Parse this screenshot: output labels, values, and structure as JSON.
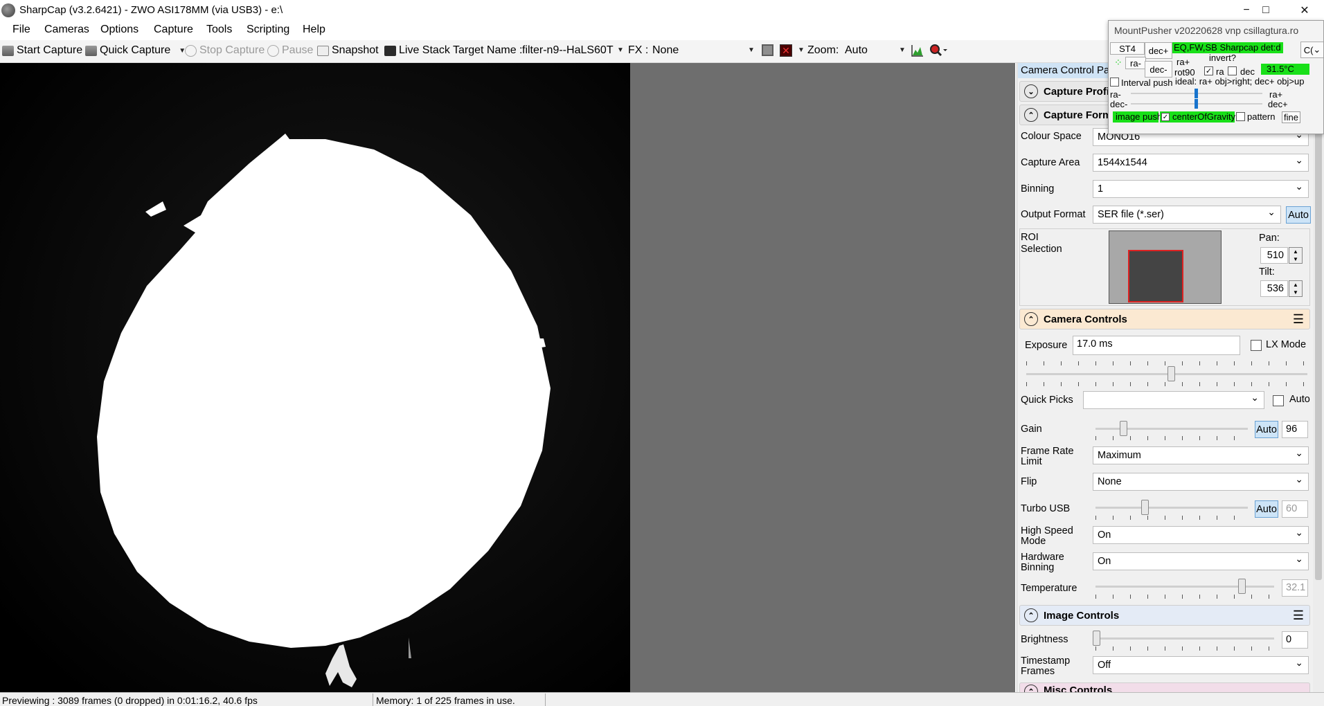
{
  "window": {
    "title": "SharpCap (v3.2.6421) - ZWO ASI178MM (via USB3) - e:\\",
    "minimize": "−",
    "maximize": "□",
    "close": "✕"
  },
  "menu": [
    "File",
    "Cameras",
    "Options",
    "Capture",
    "Tools",
    "Scripting",
    "Help"
  ],
  "toolbar": {
    "start_capture": "Start Capture",
    "quick_capture": "Quick Capture",
    "stop_capture": "Stop Capture",
    "pause": "Pause",
    "snapshot": "Snapshot",
    "live_stack": "Live Stack",
    "target_name_label": "Target Name :",
    "target_name_value": "filter-n9--HaLS60T",
    "fx_label": "FX :",
    "fx_value": "None",
    "zoom_label": "Zoom:",
    "zoom_value": "Auto"
  },
  "panel": {
    "title": "Camera Control Pa",
    "capture_profile": "Capture Profile",
    "capture_format": "Capture Forma",
    "colour_space_label": "Colour Space",
    "colour_space_value": "MONO16",
    "capture_area_label": "Capture Area",
    "capture_area_value": "1544x1544",
    "binning_label": "Binning",
    "binning_value": "1",
    "output_format_label": "Output Format",
    "output_format_value": "SER file (*.ser)",
    "output_format_auto": "Auto",
    "roi_label_1": "ROI",
    "roi_label_2": "Selection",
    "pan_label": "Pan:",
    "pan_value": "510",
    "tilt_label": "Tilt:",
    "tilt_value": "536",
    "camera_controls": "Camera Controls",
    "exposure_label": "Exposure",
    "exposure_value": "17.0 ms",
    "lx_mode": "LX Mode",
    "quick_picks_label": "Quick Picks",
    "quick_picks_auto": "Auto",
    "gain_label": "Gain",
    "gain_auto": "Auto",
    "gain_value": "96",
    "frame_rate_label_1": "Frame Rate",
    "frame_rate_label_2": "Limit",
    "frame_rate_value": "Maximum",
    "flip_label": "Flip",
    "flip_value": "None",
    "turbo_usb_label": "Turbo USB",
    "turbo_usb_auto": "Auto",
    "turbo_usb_value": "60",
    "high_speed_label_1": "High Speed",
    "high_speed_label_2": "Mode",
    "high_speed_value": "On",
    "hw_binning_label_1": "Hardware",
    "hw_binning_label_2": "Binning",
    "hw_binning_value": "On",
    "temperature_label": "Temperature",
    "temperature_value": "32.1",
    "image_controls": "Image Controls",
    "brightness_label": "Brightness",
    "brightness_value": "0",
    "timestamp_label_1": "Timestamp",
    "timestamp_label_2": "Frames",
    "timestamp_value": "Off",
    "misc_controls": "Misc Controls"
  },
  "mountpusher": {
    "title": "MountPusher v20220628 vnp csillagtura.ro",
    "st4": "ST4",
    "ra_minus": "ra-",
    "dec_plus": "dec+",
    "dec_minus": "dec-",
    "status": "EQ,FW,SB Sharpcap det:d",
    "ra_plus": "ra+",
    "rot90": "rot90",
    "invert": "invert?",
    "ra": "ra",
    "dec": "dec",
    "temp": "31.5°C",
    "interval_push": "Interval push",
    "ideal": "ideal: ra+ obj>right; dec+ obj>up",
    "slider_ra_minus": "ra-",
    "slider_dec_minus": "dec-",
    "slider_ra_plus": "ra+",
    "slider_dec_plus": "dec+",
    "image_push": "image push",
    "center_of_gravity": "centerOfGravity",
    "pattern": "pattern",
    "fine": "fine",
    "combo": "C("
  },
  "status": {
    "previewing": "Previewing : 3089 frames (0 dropped) in 0:01:16.2, 40.6 fps",
    "memory": "Memory: 1 of 225 frames in use."
  }
}
